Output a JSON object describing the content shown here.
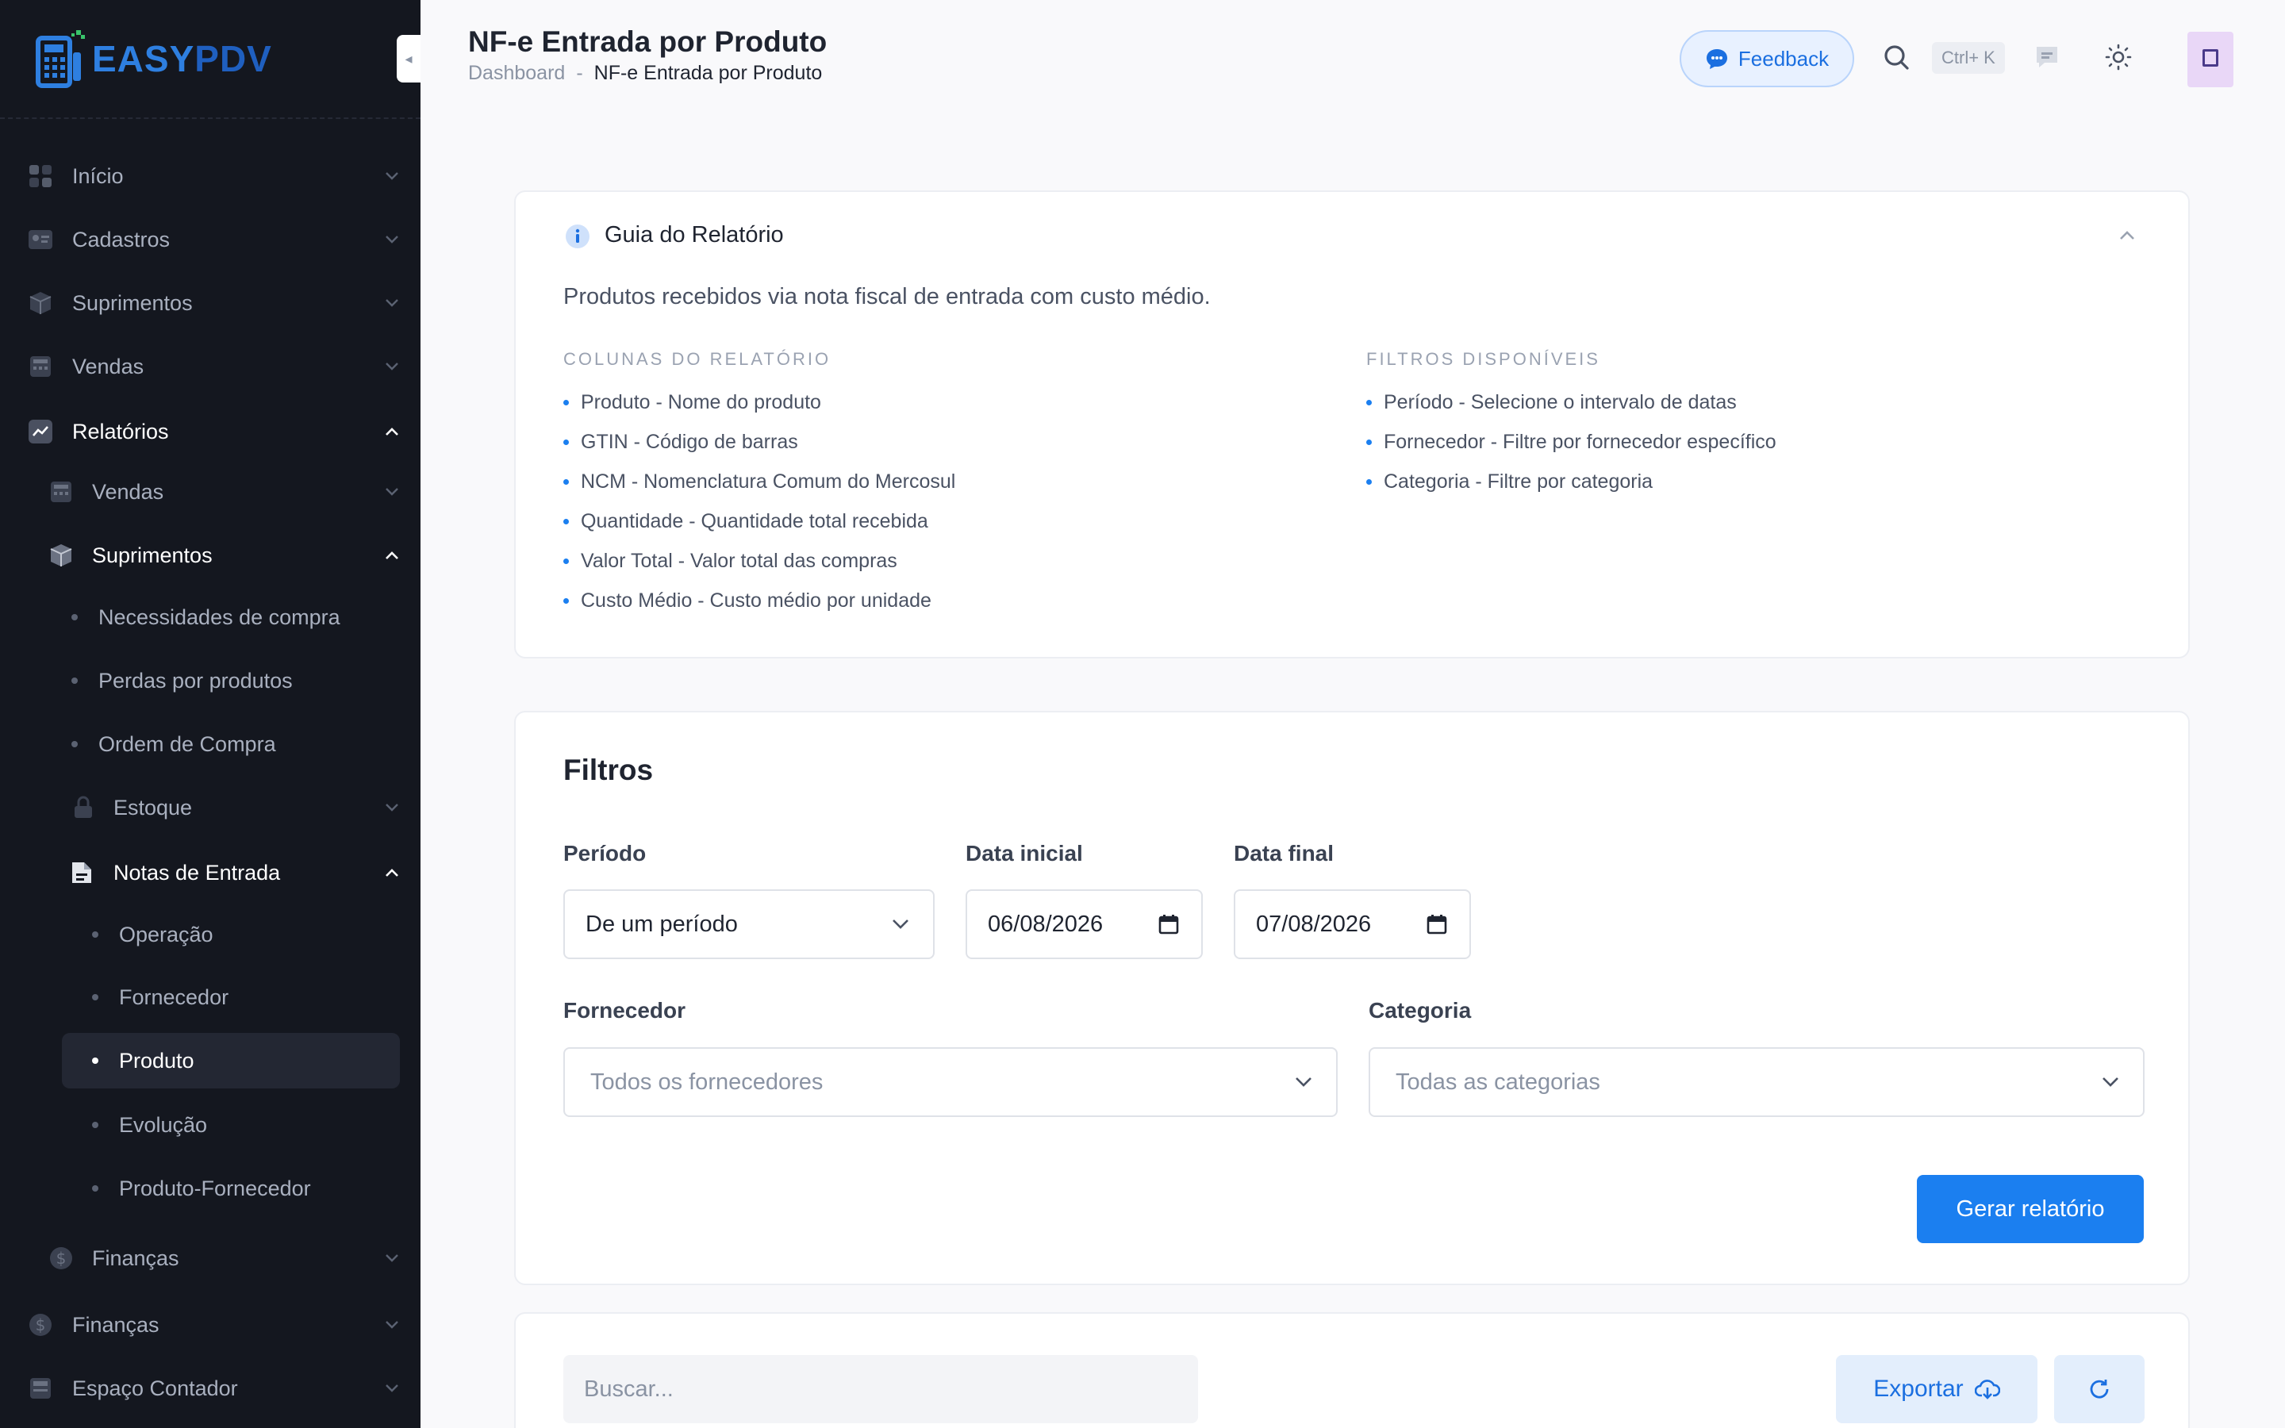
{
  "sidebar": {
    "brand": {
      "part1": "EASY",
      "part2": "PDV"
    },
    "items": [
      {
        "label": "Início",
        "icon": "grid-icon"
      },
      {
        "label": "Cadastros",
        "icon": "id-card-icon"
      },
      {
        "label": "Suprimentos",
        "icon": "box-icon"
      },
      {
        "label": "Vendas",
        "icon": "register-icon"
      },
      {
        "label": "Relatórios",
        "icon": "chart-icon"
      },
      {
        "label": "Vendas",
        "icon": "register-icon"
      },
      {
        "label": "Suprimentos",
        "icon": "box-icon"
      },
      {
        "label": "Necessidades de compra"
      },
      {
        "label": "Perdas por produtos"
      },
      {
        "label": "Ordem de Compra"
      },
      {
        "label": "Estoque",
        "icon": "lock-icon"
      },
      {
        "label": "Notas de Entrada",
        "icon": "document-icon"
      },
      {
        "label": "Operação"
      },
      {
        "label": "Fornecedor"
      },
      {
        "label": "Produto"
      },
      {
        "label": "Evolução"
      },
      {
        "label": "Produto-Fornecedor"
      },
      {
        "label": "Finanças",
        "icon": "dollar-icon"
      },
      {
        "label": "Finanças",
        "icon": "dollar-icon"
      },
      {
        "label": "Espaço Contador",
        "icon": "calculator-icon"
      }
    ]
  },
  "header": {
    "title": "NF-e Entrada por Produto",
    "breadcrumb": [
      "Dashboard",
      "NF-e Entrada por Produto"
    ],
    "breadcrumb_sep": "-",
    "feedback_label": "Feedback",
    "search_shortcut": "Ctrl+ K"
  },
  "guide": {
    "title": "Guia do Relatório",
    "description": "Produtos recebidos via nota fiscal de entrada com custo médio.",
    "columns_head": "COLUNAS DO RELATÓRIO",
    "columns": [
      "Produto - Nome do produto",
      "GTIN - Código de barras",
      "NCM - Nomenclatura Comum do Mercosul",
      "Quantidade - Quantidade total recebida",
      "Valor Total - Valor total das compras",
      "Custo Médio - Custo médio por unidade"
    ],
    "filters_head": "FILTROS DISPONÍVEIS",
    "filters": [
      "Período - Selecione o intervalo de datas",
      "Fornecedor - Filtre por fornecedor específico",
      "Categoria - Filtre por categoria"
    ]
  },
  "filters": {
    "title": "Filtros",
    "period_label": "Período",
    "period_value": "De um período",
    "start_label": "Data inicial",
    "start_value": "06/08/2026",
    "end_label": "Data final",
    "end_value": "07/08/2026",
    "supplier_label": "Fornecedor",
    "supplier_placeholder": "Todos os fornecedores",
    "category_label": "Categoria",
    "category_placeholder": "Todas as categorias",
    "submit_label": "Gerar relatório"
  },
  "results": {
    "search_placeholder": "Buscar...",
    "export_label": "Exportar"
  },
  "colors": {
    "accent": "#1b7ff0",
    "sidebar_bg": "#14171f",
    "brand_blue": "#2e7fe0",
    "page_bg": "#f9f9fb"
  }
}
